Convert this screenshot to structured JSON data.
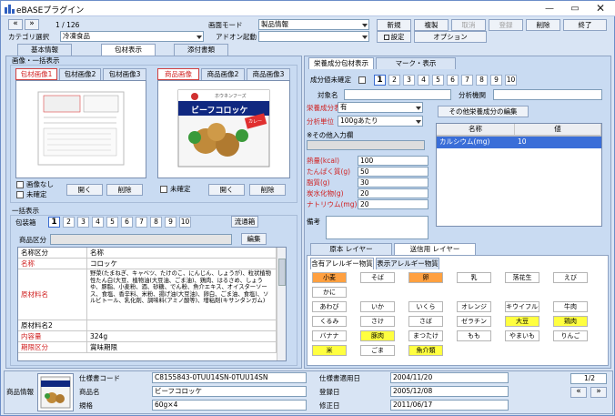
{
  "app": {
    "title": "eBASEプラグイン"
  },
  "toolbar": {
    "record_pos": "1 / 126",
    "screen_mode_label": "画面モード",
    "screen_mode_value": "製品情報",
    "category_label": "カテゴリ選択",
    "category_value": "冷凍食品",
    "addon_label": "アドオン起動",
    "new": "新規",
    "copy": "複製",
    "cancel": "取消",
    "register": "登録",
    "delete": "削除",
    "exit": "終了",
    "settings": "設定",
    "options": "オプション"
  },
  "main_tabs": [
    "基本情報",
    "包材表示",
    "添付書類"
  ],
  "left": {
    "image_group": "画像・一括表示",
    "pkg_tabs": [
      "包材画像1",
      "包材画像2",
      "包材画像3"
    ],
    "product_tabs": [
      "商品画像",
      "商品画像2",
      "商品画像3"
    ],
    "no_image": "画像なし",
    "unconfirmed": "未確定",
    "open": "開く",
    "delete": "削除",
    "unconfirmed2": "未確定",
    "open2": "開く",
    "delete2": "削除",
    "bulk_group": "一括表示",
    "pkg_tab_label": "包装箱",
    "nums": [
      "1",
      "2",
      "3",
      "4",
      "5",
      "6",
      "7",
      "8",
      "9",
      "10"
    ],
    "flow": "流通箱",
    "product_class_label": "商品区分",
    "edit": "編集"
  },
  "package_text": {
    "brand": "ホウネンフーズ",
    "name": "ビーフコロッケ",
    "badge": "カレー"
  },
  "detail": {
    "rows": [
      {
        "label": "名称区分",
        "value": "名称",
        "red": false
      },
      {
        "label": "名称",
        "value": "コロッケ",
        "red": true
      },
      {
        "label": "原材料名",
        "value": "野菜(たまねぎ、キャベツ、たけのこ、にんじん、しょうが)、粒状植物性たん白(大豆、植物油(大豆油、ごま油)、鶏肉、はるさめ、しょうゆ、豚脂、小麦粉、酒、砂糖、でん粉、魚介エキス、オイスターソース、食塩、香辛料、米粉、揚げ油(大豆油)、卵白、ごま油、食塩)、ソルビトール、乳化剤、調味料(アミノ酸等)、増粘剤(キサンタンガム)",
        "red": true
      },
      {
        "label": "原材料名2",
        "value": "",
        "red": false
      },
      {
        "label": "内容量",
        "value": "324g",
        "red": true
      },
      {
        "label": "期限区分",
        "value": "賞味期限",
        "red": true
      }
    ]
  },
  "right": {
    "tabs": [
      "栄養成分包材表示",
      "マーク・表示"
    ],
    "confirm_label": "成分値未確定",
    "nums": [
      "1",
      "2",
      "3",
      "4",
      "5",
      "6",
      "7",
      "8",
      "9",
      "10"
    ],
    "target_label": "対象名",
    "lab_label": "分析機関",
    "basis_label": "栄養成分表示",
    "basis_value": "有",
    "unit_label": "分析単位",
    "unit_value": "100gあたり",
    "other_label": "※その他入力欄",
    "edit_other": "その他栄養成分の編集",
    "table_headers": [
      "名称",
      "値"
    ],
    "table_rows": [
      {
        "name": "カルシウム(mg)",
        "value": "10"
      }
    ],
    "nutrients": [
      {
        "label": "熱量(kcal)",
        "value": "100"
      },
      {
        "label": "たんぱく質(g)",
        "value": "50"
      },
      {
        "label": "脂質(g)",
        "value": "30"
      },
      {
        "label": "炭水化物(g)",
        "value": "20"
      },
      {
        "label": "ナトリウム(mg)",
        "value": "20"
      }
    ],
    "remarks_label": "備考"
  },
  "allergy": {
    "tabs": [
      "原本 レイヤー",
      "送信用 レイヤー"
    ],
    "subtabs": [
      "含有アレルギー物質",
      "表示アレルギー物質"
    ],
    "rows": [
      [
        {
          "t": "小麦",
          "c": "#ffa040"
        },
        {
          "t": "そば",
          "c": "#fff"
        },
        {
          "t": "卵",
          "c": "#ffa040"
        },
        {
          "t": "乳",
          "c": "#fff"
        },
        {
          "t": "落花生",
          "c": "#fff"
        },
        {
          "t": "えび",
          "c": "#fff"
        }
      ],
      [
        {
          "t": "かに",
          "c": "#fff"
        }
      ],
      [
        {
          "t": "あわび",
          "c": "#fff"
        },
        {
          "t": "いか",
          "c": "#fff"
        },
        {
          "t": "いくら",
          "c": "#fff"
        },
        {
          "t": "オレンジ",
          "c": "#fff"
        },
        {
          "t": "キウイフルーツ",
          "c": "#fff"
        },
        {
          "t": "牛肉",
          "c": "#fff"
        }
      ],
      [
        {
          "t": "くるみ",
          "c": "#fff"
        },
        {
          "t": "さけ",
          "c": "#fff"
        },
        {
          "t": "さば",
          "c": "#fff"
        },
        {
          "t": "ゼラチン",
          "c": "#fff"
        },
        {
          "t": "大豆",
          "c": "#ffff40"
        },
        {
          "t": "鶏肉",
          "c": "#ffff40"
        }
      ],
      [
        {
          "t": "バナナ",
          "c": "#fff"
        },
        {
          "t": "豚肉",
          "c": "#ffff40"
        },
        {
          "t": "まつたけ",
          "c": "#fff"
        },
        {
          "t": "もも",
          "c": "#fff"
        },
        {
          "t": "やまいも",
          "c": "#fff"
        },
        {
          "t": "りんご",
          "c": "#fff"
        }
      ],
      [
        {
          "t": "米",
          "c": "#ffff40"
        },
        {
          "t": "ごま",
          "c": "#fff"
        },
        {
          "t": "魚介類",
          "c": "#ffff40"
        }
      ]
    ]
  },
  "footer": {
    "product_info": "商品情報",
    "spec_code_label": "仕様書コード",
    "spec_code": "C8155843-0TUU14SN-0TUU14SN",
    "name_label": "商品名",
    "name": "ビーフコロッケ",
    "size_label": "規格",
    "size": "60g×4",
    "apply_label": "仕様書適用日",
    "apply": "2004/11/20",
    "reg_label": "登録日",
    "reg": "2005/12/08",
    "mod_label": "修正日",
    "mod": "2011/06/17",
    "page": "1/2"
  }
}
